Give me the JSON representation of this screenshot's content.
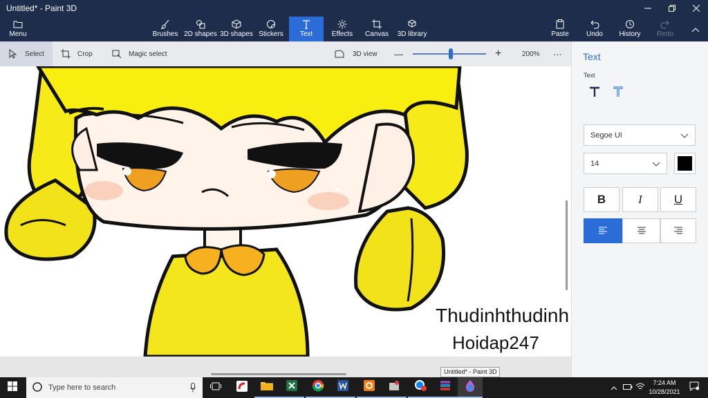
{
  "window": {
    "title": "Untitled* - Paint 3D"
  },
  "ribbon": {
    "menu_label": "Menu",
    "tabs": [
      {
        "label": "Brushes",
        "icon": "brush-icon"
      },
      {
        "label": "2D shapes",
        "icon": "shapes-2d-icon"
      },
      {
        "label": "3D shapes",
        "icon": "cube-icon"
      },
      {
        "label": "Stickers",
        "icon": "sticker-icon"
      },
      {
        "label": "Text",
        "icon": "text-icon",
        "active": true
      },
      {
        "label": "Effects",
        "icon": "effects-icon"
      },
      {
        "label": "Canvas",
        "icon": "canvas-icon"
      },
      {
        "label": "3D library",
        "icon": "library-icon"
      }
    ],
    "actions": [
      {
        "label": "Paste",
        "icon": "paste-icon"
      },
      {
        "label": "Undo",
        "icon": "undo-icon"
      },
      {
        "label": "History",
        "icon": "history-icon"
      },
      {
        "label": "Redo",
        "icon": "redo-icon",
        "disabled": true
      }
    ]
  },
  "toolbar": {
    "select_label": "Select",
    "crop_label": "Crop",
    "magic_select_label": "Magic select",
    "view3d_label": "3D view",
    "zoom_minus": "—",
    "zoom_plus": "+",
    "zoom_level": "200%",
    "more": "···",
    "zoom_slider_fraction": 0.52
  },
  "canvas": {
    "text_line1": "Thudinhthudinh",
    "text_line2": "Hoidap247",
    "tooltip": "Untitled* - Paint 3D"
  },
  "panel": {
    "title": "Text",
    "subtitle": "Text",
    "text_buttons": [
      "text-2d-icon",
      "text-3d-icon"
    ],
    "font_family": "Segoe UI",
    "font_size": "14",
    "text_color": "#000000",
    "bold": "B",
    "italic": "I",
    "underline": "U",
    "accent_color": "#2b6cd6"
  },
  "taskbar": {
    "search_placeholder": "Type here to search",
    "time": "7:24 AM",
    "date": "10/28/2021"
  }
}
